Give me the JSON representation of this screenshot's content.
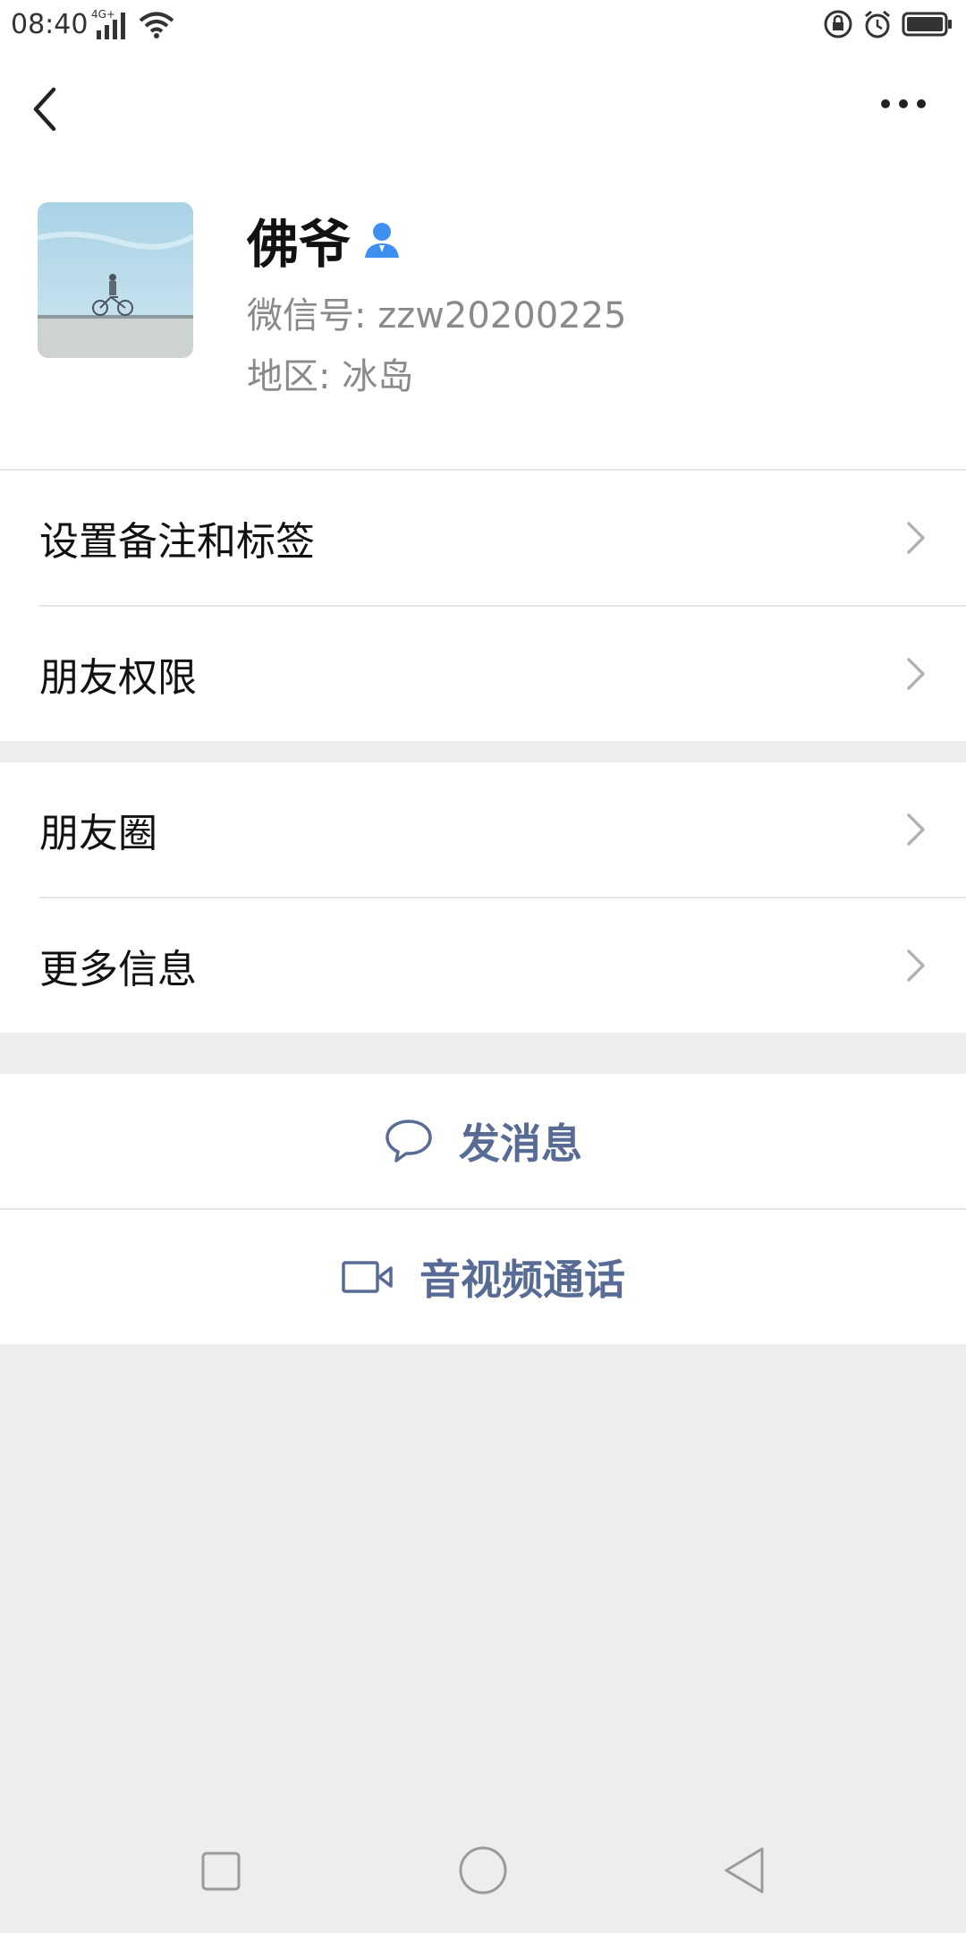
{
  "status_bar": {
    "time": "08:40",
    "network": "4G+"
  },
  "header": {
    "back_icon": "chevron-left-icon",
    "more_icon": "more-horizontal-icon"
  },
  "profile": {
    "name": "佛爷",
    "wechat_id_label": "微信号:",
    "wechat_id": "zzw20200225",
    "region_label": "地区:",
    "region": "冰岛",
    "badge_icon": "person-icon",
    "badge_color": "#3d8ff0"
  },
  "group1": {
    "items": [
      {
        "label": "设置备注和标签"
      },
      {
        "label": "朋友权限"
      }
    ]
  },
  "group2": {
    "items": [
      {
        "label": "朋友圈"
      },
      {
        "label": "更多信息"
      }
    ]
  },
  "actions": {
    "send_message": "发消息",
    "video_call": "音视频通话",
    "accent_color": "#576b95"
  }
}
